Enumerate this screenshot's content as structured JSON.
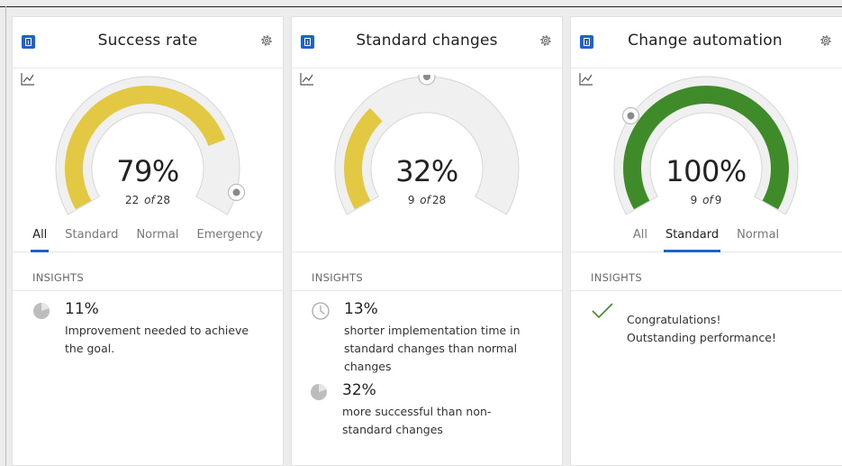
{
  "colors": {
    "accent": "#1e63c9",
    "gauge_track": "#efefef",
    "gauge_yellow": "#e3c843",
    "gauge_green": "#3f8b2a"
  },
  "cards": [
    {
      "title": "Success rate",
      "percent_label": "79%",
      "count": "22",
      "count_sep": "of",
      "total": "28",
      "fraction": 0.79,
      "fill_color": "#e3c843",
      "tabs": [
        "All",
        "Standard",
        "Normal",
        "Emergency"
      ],
      "active_tab": "All",
      "insights_label": "INSIGHTS",
      "insights": [
        {
          "icon": "pie-chart-icon",
          "value": "11%",
          "text": "Improvement needed to achieve the goal."
        }
      ]
    },
    {
      "title": "Standard changes",
      "percent_label": "32%",
      "count": "9",
      "count_sep": "of",
      "total": "28",
      "fraction": 0.32,
      "fill_color": "#e3c843",
      "tabs": [],
      "insights_label": "INSIGHTS",
      "insights": [
        {
          "icon": "clock-icon",
          "value": "13%",
          "text": "shorter implementation time in standard changes than normal changes"
        },
        {
          "icon": "pie-chart-icon",
          "value": "32%",
          "text": "more successful than non-standard changes"
        }
      ]
    },
    {
      "title": "Change automation",
      "percent_label": "100%",
      "count": "9",
      "count_sep": "of",
      "total": "9",
      "fraction": 1.0,
      "fill_color": "#3f8b2a",
      "tabs": [
        "All",
        "Standard",
        "Normal"
      ],
      "active_tab": "Standard",
      "insights_label": "INSIGHTS",
      "congrats_line1": "Congratulations!",
      "congrats_line2": "Outstanding performance!"
    }
  ]
}
